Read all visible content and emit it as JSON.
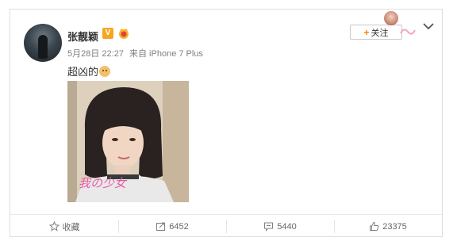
{
  "post": {
    "author_name": "张靓颖",
    "verified_badge": "V",
    "timestamp": "5月28日 22:27",
    "source": "来自 iPhone 7 Plus",
    "text": "超凶的"
  },
  "follow": {
    "label": "关注",
    "plus": "+"
  },
  "photo": {
    "overlay_text": "我の少女"
  },
  "actions": {
    "favorite_label": "收藏",
    "repost_count": "6452",
    "comment_count": "5440",
    "like_count": "23375"
  },
  "icons": [
    "verified-badge-icon",
    "member-crown-icon",
    "emoji-icon",
    "chevron-down-icon",
    "star-icon",
    "repost-icon",
    "comment-icon",
    "thumbs-up-icon"
  ],
  "colors": {
    "accent_orange": "#ff8200",
    "verified_orange": "#f6a623",
    "text_gray": "#808080",
    "border": "#d9dde2"
  }
}
